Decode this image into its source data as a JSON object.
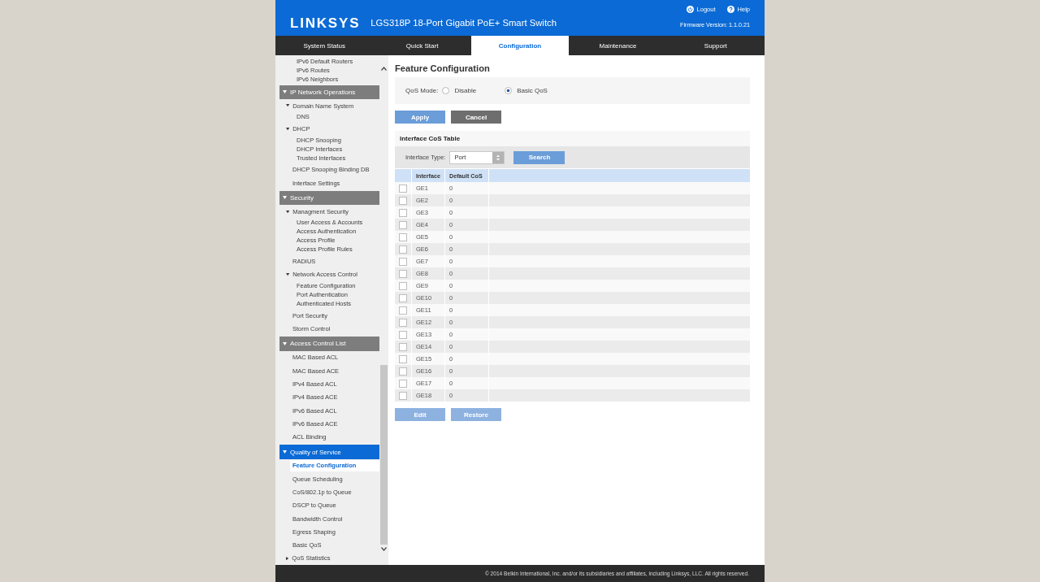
{
  "header": {
    "logo": "LINKSYS",
    "title": "LGS318P 18-Port Gigabit PoE+ Smart Switch",
    "links": [
      {
        "label": "Logout",
        "kind": "logout"
      },
      {
        "label": "Help",
        "kind": "help"
      }
    ],
    "firmware": "Firmware Version: 1.1.0.21"
  },
  "tabs": [
    {
      "label": "System Status",
      "selected": false
    },
    {
      "label": "Quick Start",
      "selected": false
    },
    {
      "label": "Configuration",
      "selected": true
    },
    {
      "label": "Maintenance",
      "selected": false
    },
    {
      "label": "Support",
      "selected": false
    }
  ],
  "sidebar": {
    "leading_items": [
      {
        "label": "IPv6 Default Routers",
        "selected": false
      },
      {
        "label": "IPv6 Routes",
        "selected": false
      },
      {
        "label": "IPv6 Neighbors",
        "selected": false
      }
    ],
    "sections": [
      {
        "label": "IP Network Operations",
        "expanded": true,
        "selected": false,
        "children": [
          {
            "label": "Domain Name System",
            "kind": "group",
            "expanded": true,
            "children": [
              {
                "label": "DNS",
                "selected": false
              }
            ]
          },
          {
            "label": "DHCP",
            "kind": "group",
            "expanded": true,
            "children": [
              {
                "label": "DHCP Snooping",
                "selected": false
              },
              {
                "label": "DHCP Interfaces",
                "selected": false
              },
              {
                "label": "Trusted Interfaces",
                "selected": false
              }
            ]
          },
          {
            "label": "DHCP Snooping Binding DB",
            "kind": "link",
            "selected": false
          },
          {
            "label": "Interface Settings",
            "kind": "link",
            "selected": false
          }
        ]
      },
      {
        "label": "Security",
        "expanded": true,
        "selected": false,
        "children": [
          {
            "label": "Managment Security",
            "kind": "group",
            "expanded": true,
            "children": [
              {
                "label": "User Access & Accounts",
                "selected": false
              },
              {
                "label": "Access Authentication",
                "selected": false
              },
              {
                "label": "Access Profile",
                "selected": false
              },
              {
                "label": "Access Profile Rules",
                "selected": false
              }
            ]
          },
          {
            "label": "RADIUS",
            "kind": "link",
            "selected": false
          },
          {
            "label": "Network Access Control",
            "kind": "group",
            "expanded": true,
            "children": [
              {
                "label": "Feature Configuration",
                "selected": false
              },
              {
                "label": "Port Authentication",
                "selected": false
              },
              {
                "label": "Authenticated Hosts",
                "selected": false
              }
            ]
          },
          {
            "label": "Port Security",
            "kind": "link",
            "selected": false
          },
          {
            "label": "Storm Control",
            "kind": "link",
            "selected": false
          }
        ]
      },
      {
        "label": "Access Control List",
        "expanded": true,
        "selected": false,
        "children": [
          {
            "label": "MAC Based ACL",
            "kind": "link",
            "selected": false
          },
          {
            "label": "MAC Based ACE",
            "kind": "link",
            "selected": false
          },
          {
            "label": "IPv4 Based ACL",
            "kind": "link",
            "selected": false
          },
          {
            "label": "IPv4 Based ACE",
            "kind": "link",
            "selected": false
          },
          {
            "label": "IPv6 Based ACL",
            "kind": "link",
            "selected": false
          },
          {
            "label": "IPv6 Based ACE",
            "kind": "link",
            "selected": false
          },
          {
            "label": "ACL Binding",
            "kind": "link",
            "selected": false
          }
        ]
      },
      {
        "label": "Quality of Service",
        "expanded": true,
        "selected": true,
        "children": [
          {
            "label": "Feature Configuration",
            "kind": "link",
            "selected": true
          },
          {
            "label": "Queue Scheduling",
            "kind": "link",
            "selected": false
          },
          {
            "label": "CoS/802.1p to Queue",
            "kind": "link",
            "selected": false
          },
          {
            "label": "DSCP to Queue",
            "kind": "link",
            "selected": false
          },
          {
            "label": "Bandwidth Control",
            "kind": "link",
            "selected": false
          },
          {
            "label": "Egress Shaping",
            "kind": "link",
            "selected": false
          },
          {
            "label": "Basic QoS",
            "kind": "link",
            "selected": false
          },
          {
            "label": "QoS Statistics",
            "kind": "group",
            "expanded": false
          }
        ]
      }
    ]
  },
  "page": {
    "title": "Feature Configuration",
    "qos_mode": {
      "label": "QoS Mode:",
      "options": [
        {
          "label": "Disable",
          "selected": false
        },
        {
          "label": "Basic QoS",
          "selected": true
        }
      ]
    },
    "buttons": [
      {
        "label": "Apply",
        "kind": "primary",
        "disabled": false
      },
      {
        "label": "Cancel",
        "kind": "secondary",
        "disabled": false
      }
    ],
    "table": {
      "title": "Interface CoS Table",
      "filter": {
        "label": "Interface Type:",
        "value": "Port",
        "button": "Search"
      },
      "columns": [
        "Interface",
        "Default CoS"
      ],
      "rows": [
        {
          "cells": [
            "GE1",
            "0"
          ],
          "checked": false
        },
        {
          "cells": [
            "GE2",
            "0"
          ],
          "checked": false
        },
        {
          "cells": [
            "GE3",
            "0"
          ],
          "checked": false
        },
        {
          "cells": [
            "GE4",
            "0"
          ],
          "checked": false
        },
        {
          "cells": [
            "GE5",
            "0"
          ],
          "checked": false
        },
        {
          "cells": [
            "GE6",
            "0"
          ],
          "checked": false
        },
        {
          "cells": [
            "GE7",
            "0"
          ],
          "checked": false
        },
        {
          "cells": [
            "GE8",
            "0"
          ],
          "checked": false
        },
        {
          "cells": [
            "GE9",
            "0"
          ],
          "checked": false
        },
        {
          "cells": [
            "GE10",
            "0"
          ],
          "checked": false
        },
        {
          "cells": [
            "GE11",
            "0"
          ],
          "checked": false
        },
        {
          "cells": [
            "GE12",
            "0"
          ],
          "checked": false
        },
        {
          "cells": [
            "GE13",
            "0"
          ],
          "checked": false
        },
        {
          "cells": [
            "GE14",
            "0"
          ],
          "checked": false
        },
        {
          "cells": [
            "GE15",
            "0"
          ],
          "checked": false
        },
        {
          "cells": [
            "GE16",
            "0"
          ],
          "checked": false
        },
        {
          "cells": [
            "GE17",
            "0"
          ],
          "checked": false
        },
        {
          "cells": [
            "GE18",
            "0"
          ],
          "checked": false
        }
      ],
      "buttons": [
        {
          "label": "Edit",
          "disabled": true
        },
        {
          "label": "Restore",
          "disabled": true
        }
      ]
    }
  },
  "footer": "© 2014 Belkin International, Inc. and/or its subsidiaries and affiliates, including Linksys, LLC. All rights reserved."
}
